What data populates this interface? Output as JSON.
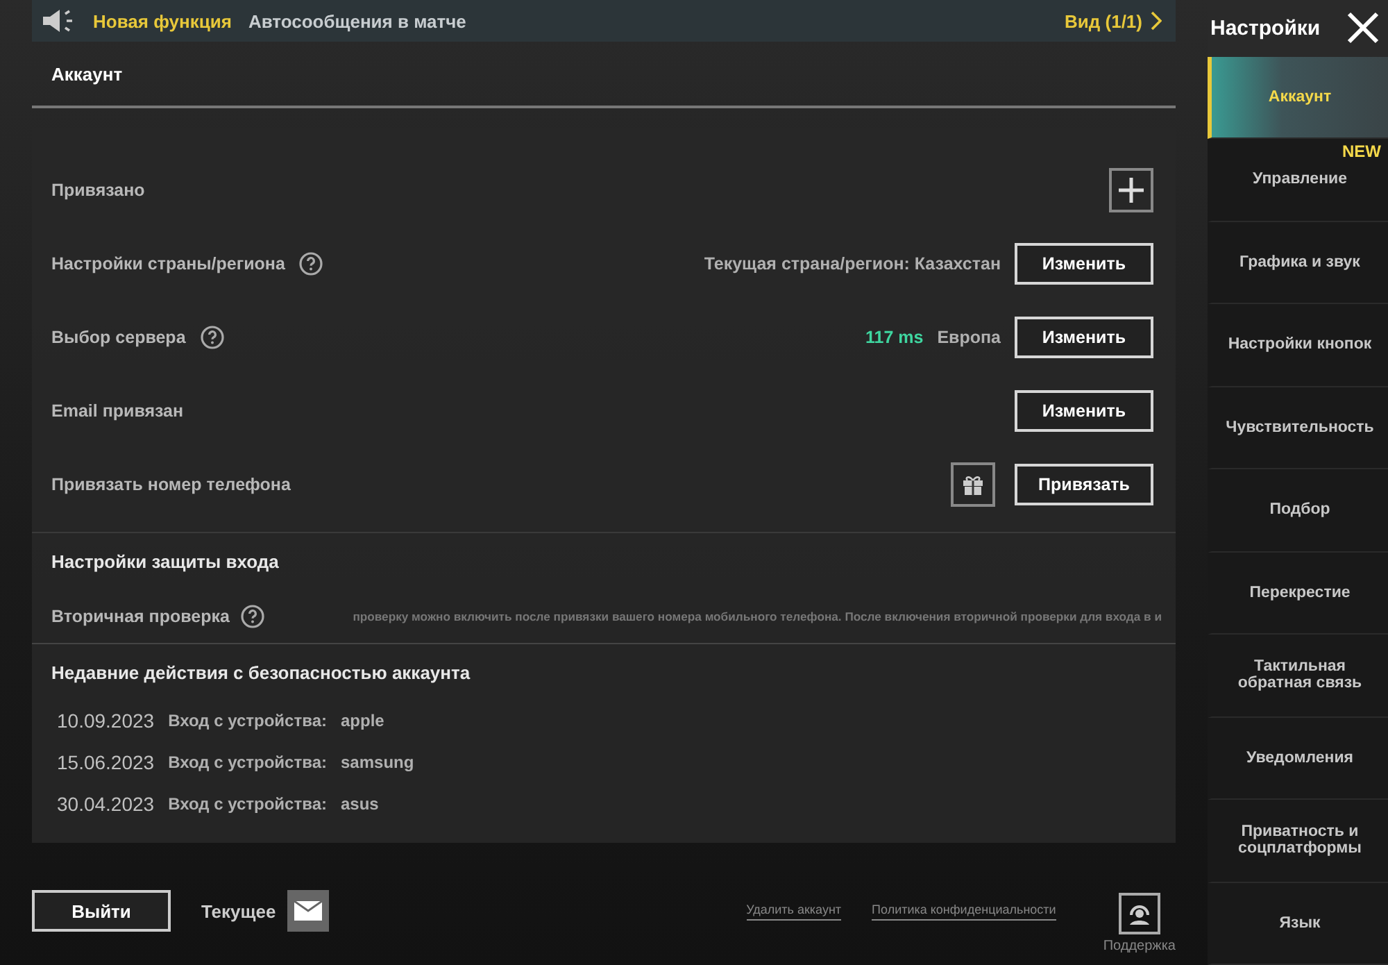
{
  "banner": {
    "label": "Новая функция",
    "text": "Автосообщения в матче",
    "link": "Вид (1/1)"
  },
  "section_title": "Аккаунт",
  "rows": [
    {
      "kind": "add",
      "label": "Привязано",
      "help": false
    },
    {
      "kind": "button",
      "label": "Настройки страны/региона",
      "help": true,
      "value": "Текущая страна/регион: Казахстан",
      "button": "Изменить"
    },
    {
      "kind": "button",
      "label": "Выбор сервера",
      "help": true,
      "ping": "117 ms",
      "value": "Европа",
      "button": "Изменить"
    },
    {
      "kind": "button",
      "label": "Email привязан",
      "help": false,
      "button": "Изменить"
    },
    {
      "kind": "gift",
      "label": "Привязать номер телефона",
      "help": false,
      "button": "Привязать"
    }
  ],
  "security": {
    "title": "Настройки защиты входа",
    "label": "Вторичная проверка",
    "help": true,
    "text": "проверку можно включить после привязки вашего номера мобильного телефона. После включения вторичной проверки для входа в и"
  },
  "recent": {
    "title": "Недавние действия с безопасностью аккаунта",
    "entries": [
      {
        "date": "10.09.2023",
        "action": "Вход с устройства:",
        "device": "apple"
      },
      {
        "date": "15.06.2023",
        "action": "Вход с устройства:",
        "device": "samsung"
      },
      {
        "date": "30.04.2023",
        "action": "Вход с устройства:",
        "device": "asus"
      }
    ]
  },
  "footer": {
    "logout": "Выйти",
    "current": "Текущее",
    "links": [
      "Удалить аккаунт",
      "Политика конфиденциальности"
    ],
    "support": "Поддержка"
  },
  "sidebar": {
    "title": "Настройки",
    "items": [
      {
        "label": "Аккаунт",
        "selected": true
      },
      {
        "label": "Управление",
        "selected": false,
        "badge": "NEW"
      },
      {
        "label": "Графика и звук",
        "selected": false
      },
      {
        "label": "Настройки кнопок",
        "selected": false
      },
      {
        "label": "Чувствительность",
        "selected": false
      },
      {
        "label": "Подбор",
        "selected": false
      },
      {
        "label": "Перекрестие",
        "selected": false
      },
      {
        "label": "Тактильная обратная связь",
        "selected": false
      },
      {
        "label": "Уведомления",
        "selected": false
      },
      {
        "label": "Приватность и соцплатформы",
        "selected": false
      },
      {
        "label": "Язык",
        "selected": false
      }
    ]
  }
}
